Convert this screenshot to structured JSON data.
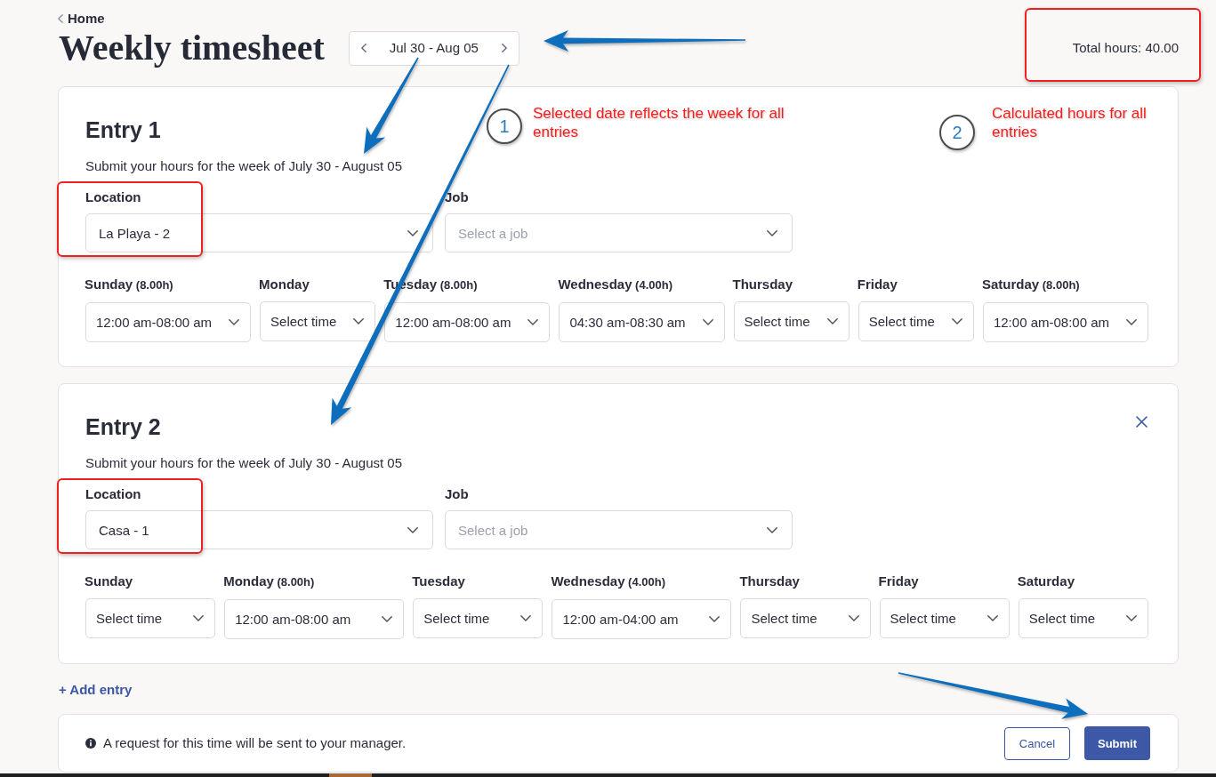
{
  "breadcrumb": {
    "label": "Home"
  },
  "title": "Weekly timesheet",
  "week_picker": {
    "range": "Jul 30 - Aug 05"
  },
  "total_hours": {
    "text": "Total hours: 40.00",
    "highlighted": true
  },
  "entries": [
    {
      "title": "Entry 1",
      "removable": false,
      "subtitle": "Submit your hours for the week of July 30 - August 05",
      "location": {
        "label": "Location",
        "value": "La Playa - 2",
        "highlighted": true
      },
      "job": {
        "label": "Job",
        "placeholder": "Select a job"
      },
      "days": [
        {
          "day": "Sunday",
          "hours": "(8.00h)",
          "value": "12:00 am-08:00 am"
        },
        {
          "day": "Monday",
          "placeholder": "Select time"
        },
        {
          "day": "Tuesday",
          "hours": "(8.00h)",
          "value": "12:00 am-08:00 am"
        },
        {
          "day": "Wednesday",
          "hours": "(4.00h)",
          "value": "04:30 am-08:30 am"
        },
        {
          "day": "Thursday",
          "placeholder": "Select time"
        },
        {
          "day": "Friday",
          "placeholder": "Select time"
        },
        {
          "day": "Saturday",
          "hours": "(8.00h)",
          "value": "12:00 am-08:00 am"
        }
      ]
    },
    {
      "title": "Entry 2",
      "removable": true,
      "subtitle": "Submit your hours for the week of July 30 - August 05",
      "location": {
        "label": "Location",
        "value": "Casa - 1",
        "highlighted": true
      },
      "job": {
        "label": "Job",
        "placeholder": "Select a job"
      },
      "days": [
        {
          "day": "Sunday",
          "placeholder": "Select time"
        },
        {
          "day": "Monday",
          "hours": "(8.00h)",
          "value": "12:00 am-08:00 am"
        },
        {
          "day": "Tuesday",
          "placeholder": "Select time"
        },
        {
          "day": "Wednesday",
          "hours": "(4.00h)",
          "value": "12:00 am-04:00 am"
        },
        {
          "day": "Thursday",
          "placeholder": "Select time"
        },
        {
          "day": "Friday",
          "placeholder": "Select time"
        },
        {
          "day": "Saturday",
          "placeholder": "Select time"
        }
      ]
    }
  ],
  "add_entry": {
    "label": "+ Add entry"
  },
  "footer": {
    "notice": "A request for this time will be sent to your manager.",
    "buttons": [
      {
        "label": "Cancel",
        "kind": "secondary"
      },
      {
        "label": "Submit",
        "kind": "primary"
      }
    ]
  },
  "annotations": [
    {
      "number": "1",
      "text": "Selected date reflects the week for all entries"
    },
    {
      "number": "2",
      "text": "Calculated hours for all entries"
    }
  ]
}
